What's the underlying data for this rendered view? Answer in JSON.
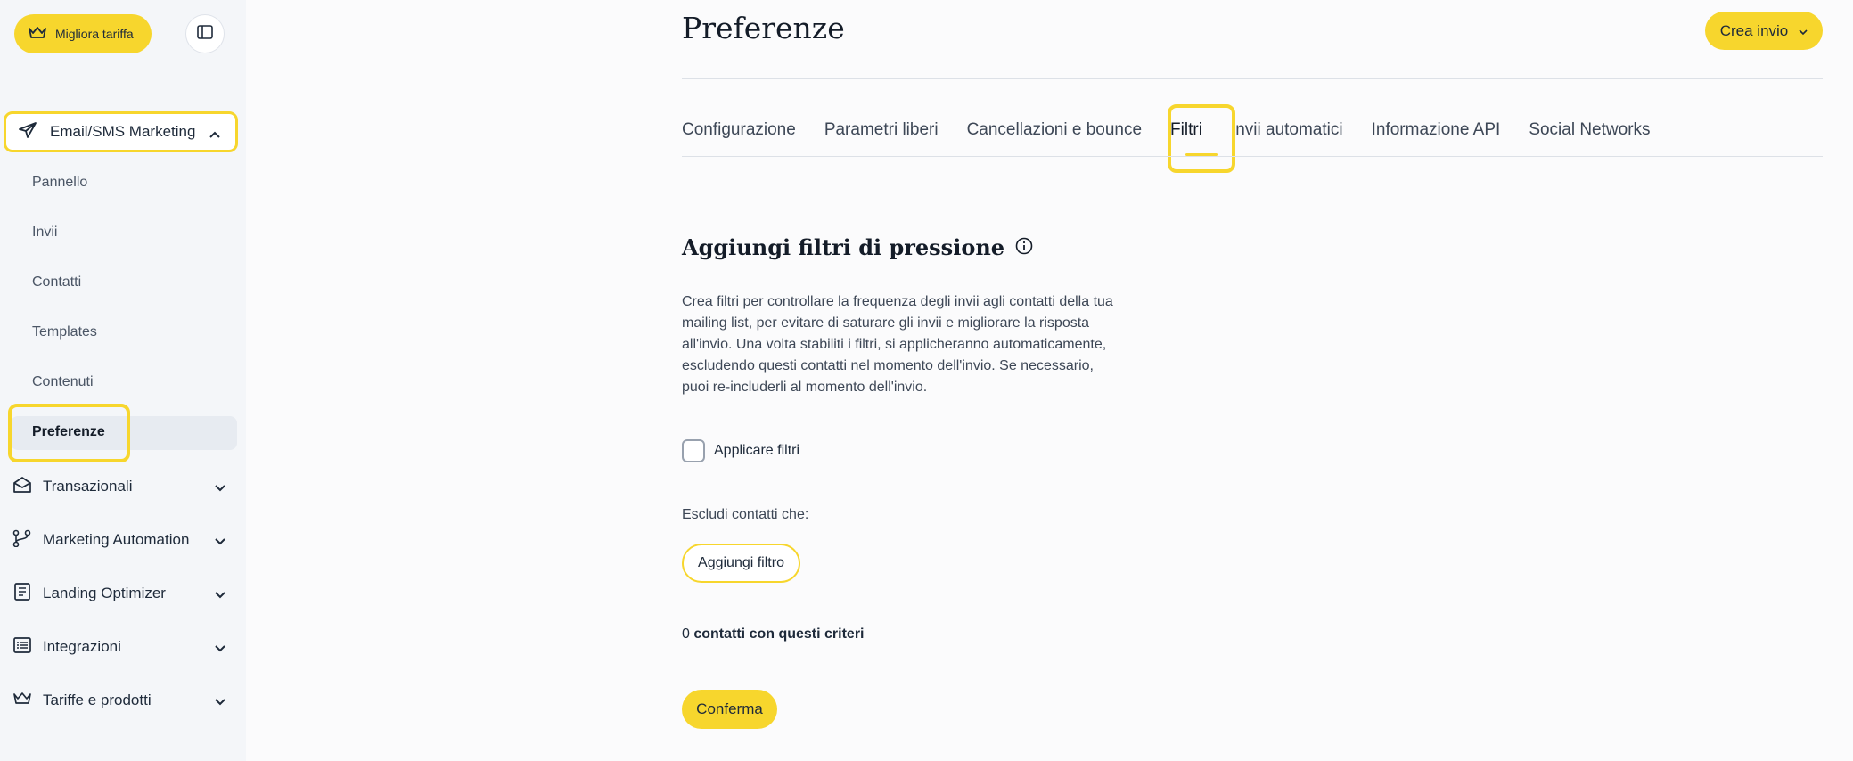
{
  "sidebar": {
    "upgrade_label": "Migliora tariffa",
    "section_label": "Email/SMS Marketing",
    "sub_items": [
      "Pannello",
      "Invii",
      "Contatti",
      "Templates",
      "Contenuti",
      "Preferenze"
    ],
    "active_item": "Preferenze",
    "groups": [
      {
        "label": "Transazionali",
        "icon": "envelope-open-icon"
      },
      {
        "label": "Marketing Automation",
        "icon": "branch-icon"
      },
      {
        "label": "Landing Optimizer",
        "icon": "document-icon"
      },
      {
        "label": "Integrazioni",
        "icon": "list-icon"
      },
      {
        "label": "Tariffe e prodotti",
        "icon": "crown-icon"
      }
    ]
  },
  "header": {
    "title": "Preferenze",
    "create_label": "Crea invio"
  },
  "tabs": [
    {
      "label": "Configurazione"
    },
    {
      "label": "Parametri liberi"
    },
    {
      "label": "Cancellazioni e bounce"
    },
    {
      "label": "Filtri",
      "active": true
    },
    {
      "label": "Invii automatici"
    },
    {
      "label": "Informazione API"
    },
    {
      "label": "Social Networks"
    }
  ],
  "filters": {
    "title": "Aggiungi filtri di pressione",
    "description_lines": [
      "Crea filtri per controllare la frequenza degli invii agli contatti della tua",
      "mailing list, per evitare di saturare gli invii e migliorare la risposta",
      "all'invio. Una volta stabiliti i filtri, si applicheranno automaticamente,",
      "escludendo questi contatti nel momento dell'invio. Se necessario,",
      "puoi re-includerli al momento dell'invio."
    ],
    "apply_label": "Applicare filtri",
    "apply_checked": false,
    "exclude_label": "Escludi contatti che:",
    "add_filter_label": "Aggiungi filtro",
    "count_value": "0",
    "count_text": "contatti con questi criteri",
    "confirm_label": "Conferma"
  },
  "colors": {
    "accent": "#f7d62d",
    "sidebar_bg": "#f4f6f9",
    "text": "#1e2a3a"
  }
}
